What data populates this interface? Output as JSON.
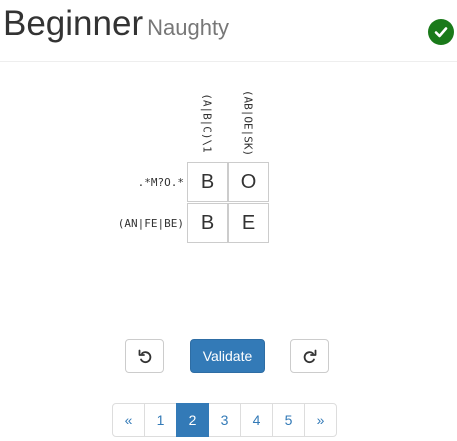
{
  "header": {
    "title": "Beginner",
    "subtitle": "Naughty",
    "status_icon": "check-circle-icon",
    "status_color": "#1a7a1a"
  },
  "puzzle": {
    "column_clues": [
      "(A|B|C)\\1",
      "(AB|OE|SK)"
    ],
    "row_clues": [
      ".*M?O.*",
      "(AN|FE|BE)"
    ],
    "grid": [
      [
        "B",
        "O"
      ],
      [
        "B",
        "E"
      ]
    ]
  },
  "controls": {
    "undo_icon": "undo-icon",
    "validate_label": "Validate",
    "redo_icon": "redo-icon"
  },
  "pagination": {
    "prev": "«",
    "pages": [
      "1",
      "2",
      "3",
      "4",
      "5"
    ],
    "active_page": "2",
    "next": "»"
  },
  "colors": {
    "primary": "#337ab7",
    "success": "#1a7a1a"
  }
}
